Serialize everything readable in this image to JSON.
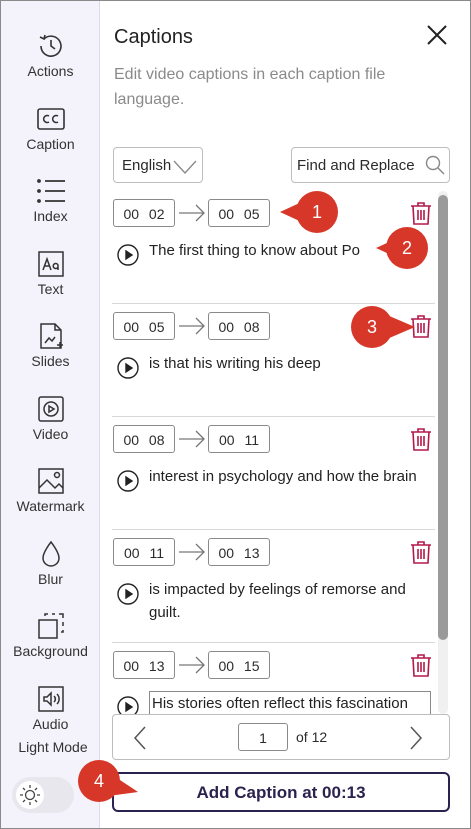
{
  "sidebar": {
    "items": [
      {
        "label": "Actions",
        "icon": "history-icon"
      },
      {
        "label": "Caption",
        "icon": "cc-icon"
      },
      {
        "label": "Index",
        "icon": "list-icon"
      },
      {
        "label": "Text",
        "icon": "text-icon"
      },
      {
        "label": "Slides",
        "icon": "slides-icon"
      },
      {
        "label": "Video",
        "icon": "video-icon"
      },
      {
        "label": "Watermark",
        "icon": "image-icon"
      },
      {
        "label": "Blur",
        "icon": "droplet-icon"
      },
      {
        "label": "Background",
        "icon": "background-icon"
      },
      {
        "label": "Audio",
        "icon": "audio-icon"
      }
    ],
    "mode_label": "Light Mode",
    "mode_icon": "sun-icon"
  },
  "panel": {
    "title": "Captions",
    "subtitle": "Edit video captions in each caption file language.",
    "language": "English",
    "find_replace": "Find and Replace"
  },
  "captions": [
    {
      "start": "00 02",
      "end": "00 05",
      "text": "The first thing to know about Po"
    },
    {
      "start": "00 05",
      "end": "00 08",
      "text": "is that his writing his deep"
    },
    {
      "start": "00 08",
      "end": "00 11",
      "text": "interest in psychology and how the brain"
    },
    {
      "start": "00 11",
      "end": "00 13",
      "text": "is impacted by feelings of remorse and guilt."
    },
    {
      "start": "00 13",
      "end": "00 15",
      "text": "His stories often reflect this fascination"
    }
  ],
  "pager": {
    "page": "1",
    "of_label": "of 12"
  },
  "add_button": "Add Caption at 00:13",
  "callouts": [
    "1",
    "2",
    "3",
    "4"
  ],
  "colors": {
    "accent": "#2c2250",
    "danger": "#b3194a",
    "callout": "#d73728",
    "sidebar_bg": "#f4f2fa"
  }
}
